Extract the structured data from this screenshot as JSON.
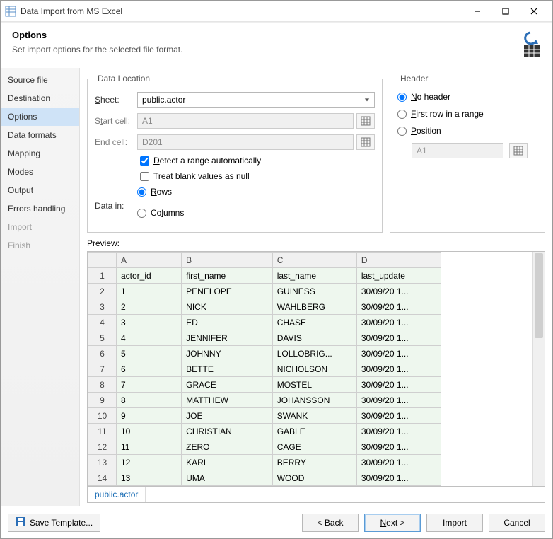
{
  "titlebar": {
    "title": "Data Import from MS Excel"
  },
  "header": {
    "title": "Options",
    "subtitle": "Set import options for the selected file format."
  },
  "sidebar": {
    "items": [
      {
        "label": "Source file"
      },
      {
        "label": "Destination"
      },
      {
        "label": "Options"
      },
      {
        "label": "Data formats"
      },
      {
        "label": "Mapping"
      },
      {
        "label": "Modes"
      },
      {
        "label": "Output"
      },
      {
        "label": "Errors handling"
      },
      {
        "label": "Import"
      },
      {
        "label": "Finish"
      }
    ]
  },
  "dataLocation": {
    "legend": "Data Location",
    "sheetLabel": "Sheet:",
    "sheetValue": "public.actor",
    "startLabel": "Start cell:",
    "startValue": "A1",
    "endLabel": "End cell:",
    "endValue": "D201",
    "detectLabel": "Detect a range automatically",
    "treatBlankLabel": "Treat blank values as null",
    "dataInLabel": "Data in:",
    "rowsLabel": "Rows",
    "colsLabel": "Columns"
  },
  "headerGroup": {
    "legend": "Header",
    "noHeader": "No header",
    "firstRow": "First row in a range",
    "position": "Position",
    "positionValue": "A1"
  },
  "preview": {
    "label": "Preview:",
    "colHeaders": [
      "",
      "A",
      "B",
      "C",
      "D"
    ],
    "rows": [
      {
        "n": "1",
        "a": "actor_id",
        "b": "first_name",
        "c": "last_name",
        "d": "last_update"
      },
      {
        "n": "2",
        "a": "1",
        "b": "PENELOPE",
        "c": "GUINESS",
        "d": "30/09/20 1..."
      },
      {
        "n": "3",
        "a": "2",
        "b": "NICK",
        "c": "WAHLBERG",
        "d": "30/09/20 1..."
      },
      {
        "n": "4",
        "a": "3",
        "b": "ED",
        "c": "CHASE",
        "d": "30/09/20 1..."
      },
      {
        "n": "5",
        "a": "4",
        "b": "JENNIFER",
        "c": "DAVIS",
        "d": "30/09/20 1..."
      },
      {
        "n": "6",
        "a": "5",
        "b": "JOHNNY",
        "c": "LOLLOBRIG...",
        "d": "30/09/20 1..."
      },
      {
        "n": "7",
        "a": "6",
        "b": "BETTE",
        "c": "NICHOLSON",
        "d": "30/09/20 1..."
      },
      {
        "n": "8",
        "a": "7",
        "b": "GRACE",
        "c": "MOSTEL",
        "d": "30/09/20 1..."
      },
      {
        "n": "9",
        "a": "8",
        "b": "MATTHEW",
        "c": "JOHANSSON",
        "d": "30/09/20 1..."
      },
      {
        "n": "10",
        "a": "9",
        "b": "JOE",
        "c": "SWANK",
        "d": "30/09/20 1..."
      },
      {
        "n": "11",
        "a": "10",
        "b": "CHRISTIAN",
        "c": "GABLE",
        "d": "30/09/20 1..."
      },
      {
        "n": "12",
        "a": "11",
        "b": "ZERO",
        "c": "CAGE",
        "d": "30/09/20 1..."
      },
      {
        "n": "13",
        "a": "12",
        "b": "KARL",
        "c": "BERRY",
        "d": "30/09/20 1..."
      },
      {
        "n": "14",
        "a": "13",
        "b": "UMA",
        "c": "WOOD",
        "d": "30/09/20 1..."
      }
    ],
    "sheetTab": "public.actor"
  },
  "footer": {
    "saveTemplate": "Save Template...",
    "back": "< Back",
    "next": "Next >",
    "import": "Import",
    "cancel": "Cancel"
  }
}
